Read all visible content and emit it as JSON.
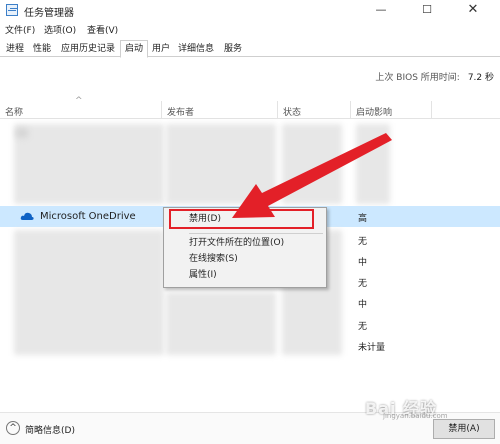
{
  "window": {
    "title": "任务管理器",
    "minimize": "—",
    "maximize": "☐",
    "close": "✕"
  },
  "menu": [
    "文件(F)",
    "选项(O)",
    "查看(V)"
  ],
  "tabs": [
    "进程",
    "性能",
    "应用历史记录",
    "启动",
    "用户",
    "详细信息",
    "服务"
  ],
  "active_tab": "启动",
  "bios": {
    "label": "上次 BIOS 所用时间:",
    "value": "7.2 秒"
  },
  "columns": [
    "名称",
    "发布者",
    "状态",
    "启动影响"
  ],
  "selected_row": {
    "name": "Microsoft OneDrive",
    "icon": "onedrive-cloud-icon"
  },
  "impacts": [
    "高",
    "无",
    "中",
    "无",
    "中",
    "无",
    "未计量"
  ],
  "context_menu": [
    "禁用(D)",
    "打开文件所在的位置(O)",
    "在线搜索(S)",
    "属性(I)"
  ],
  "footer": {
    "brief_label": "简略信息(D)",
    "disable_button": "禁用(A)"
  },
  "watermark": {
    "text": "Bai 经验",
    "sub": "jingyan.baidu.com"
  },
  "colors": {
    "selection": "#cce8ff",
    "annotation_red": "#e32028",
    "onedrive_blue": "#0f62c4"
  }
}
